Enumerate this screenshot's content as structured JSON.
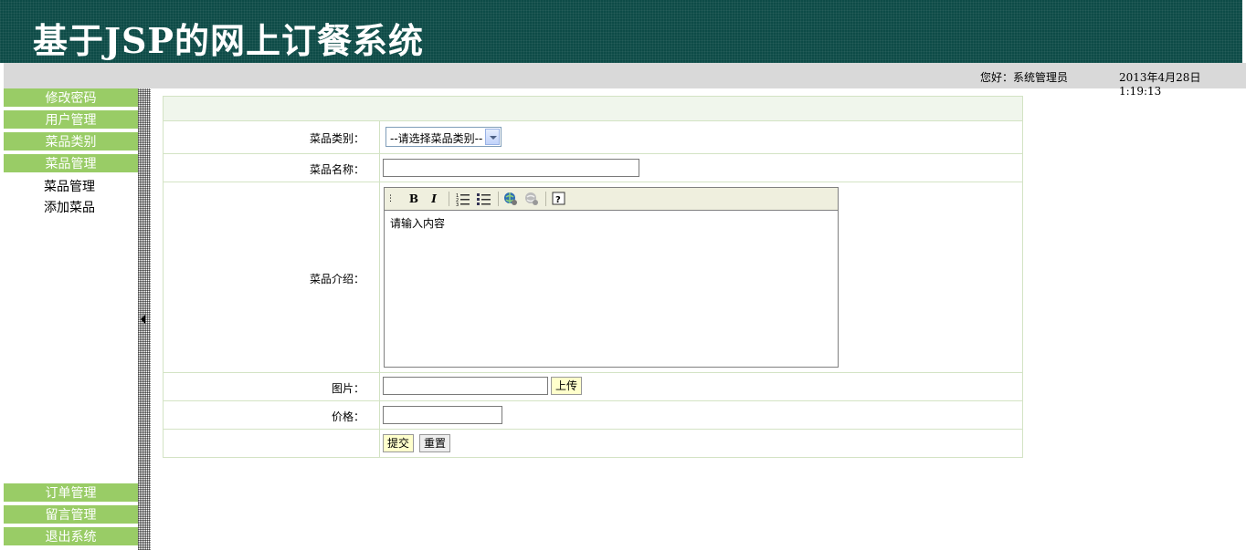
{
  "header": {
    "title": "基于JSP的网上订餐系统"
  },
  "status": {
    "greeting": "您好：系统管理员",
    "datetime": "2013年4月28日  1:19:13"
  },
  "sidebar": {
    "top_items": [
      {
        "label": "修改密码"
      },
      {
        "label": "用户管理"
      },
      {
        "label": "菜品类别"
      },
      {
        "label": "菜品管理"
      }
    ],
    "sub_items": [
      {
        "label": "菜品管理"
      },
      {
        "label": "添加菜品"
      }
    ],
    "bottom_items": [
      {
        "label": "订单管理"
      },
      {
        "label": "留言管理"
      },
      {
        "label": "退出系统"
      }
    ]
  },
  "form": {
    "category": {
      "label": "菜品类别：",
      "value": "--请选择菜品类别--"
    },
    "name": {
      "label": "菜品名称：",
      "value": ""
    },
    "intro": {
      "label": "菜品介绍：",
      "content": "请输入内容"
    },
    "image": {
      "label": "图片：",
      "value": "",
      "upload_label": "上传"
    },
    "price": {
      "label": "价格：",
      "value": ""
    },
    "submit_label": "提交",
    "reset_label": "重置"
  },
  "editor_toolbar": {
    "bold": "B",
    "italic": "I",
    "icons": [
      "bold-icon",
      "italic-icon",
      "ordered-list-icon",
      "unordered-list-icon",
      "link-icon",
      "unlink-icon",
      "help-icon"
    ]
  },
  "colors": {
    "header_bg": "#0d4b47",
    "menu_green": "#99cc66",
    "status_bar": "#d9d9d9",
    "form_border": "#d3e3c4",
    "form_header_bg": "#f0f6ec",
    "button_yellow": "#ffffcc"
  }
}
